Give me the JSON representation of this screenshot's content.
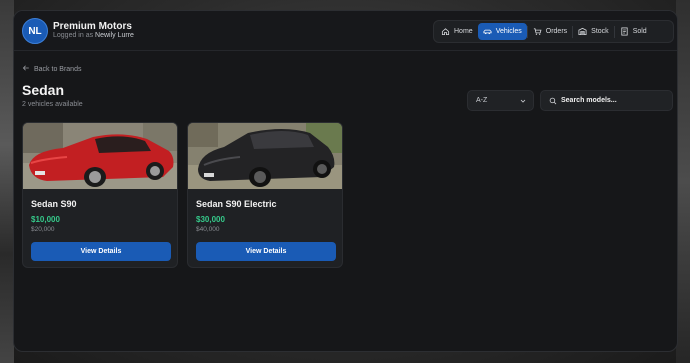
{
  "header": {
    "avatar_initials": "NL",
    "brand": "Premium Motors",
    "logged_in_prefix": "Logged in as",
    "user_name": "Newily Lurre"
  },
  "nav": {
    "items": [
      {
        "label": "Home",
        "icon": "home-icon",
        "active": false
      },
      {
        "label": "Vehicles",
        "icon": "car-icon",
        "active": true
      },
      {
        "label": "Orders",
        "icon": "cart-icon",
        "active": false
      },
      {
        "label": "Stock",
        "icon": "warehouse-icon",
        "active": false
      },
      {
        "label": "Sold",
        "icon": "receipt-icon",
        "active": false
      }
    ]
  },
  "page": {
    "back_label": "Back to Brands",
    "title": "Sedan",
    "subtitle": "2 vehicles available"
  },
  "controls": {
    "sort_value": "A-Z",
    "search_placeholder": "Search models..."
  },
  "vehicles": [
    {
      "name": "Sedan S90",
      "price": "$10,000",
      "old_price": "$20,000",
      "button": "View Details",
      "color": "red"
    },
    {
      "name": "Sedan S90 Electric",
      "price": "$30,000",
      "old_price": "$40,000",
      "button": "View Details",
      "color": "black"
    }
  ],
  "colors": {
    "accent": "#1a5bb5",
    "price": "#35c98a",
    "window_bg": "#161719",
    "card_bg": "#1f2124"
  }
}
